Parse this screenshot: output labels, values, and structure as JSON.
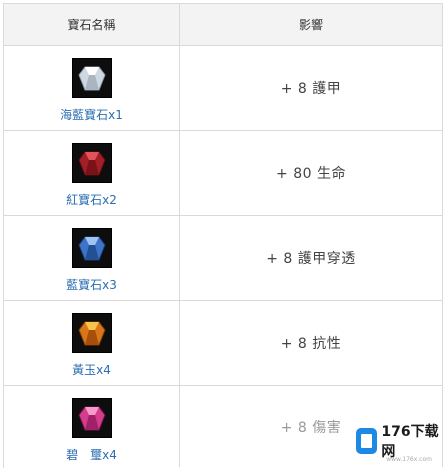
{
  "table": {
    "headers": {
      "name": "寶石名稱",
      "effect": "影響"
    },
    "rows": [
      {
        "gem": "海藍寶石x1",
        "effect": "+ 8 護甲",
        "icon": "aquamarine-gem-icon",
        "color": "#d8e0e8"
      },
      {
        "gem": "紅寶石x2",
        "effect": "+ 80 生命",
        "icon": "ruby-gem-icon",
        "color": "#b4262c"
      },
      {
        "gem": "藍寶石x3",
        "effect": "+ 8 護甲穿透",
        "icon": "sapphire-gem-icon",
        "color": "#3b74c9"
      },
      {
        "gem": "黃玉x4",
        "effect": "+ 8 抗性",
        "icon": "topaz-gem-icon",
        "color": "#e08a1e"
      },
      {
        "gem": "碧　璽x4",
        "effect": "+ 8 傷害",
        "icon": "tourmaline-gem-icon",
        "color": "#d63c8e"
      }
    ]
  },
  "watermark": {
    "text": "176下载网",
    "sub": "www.176x.com"
  }
}
